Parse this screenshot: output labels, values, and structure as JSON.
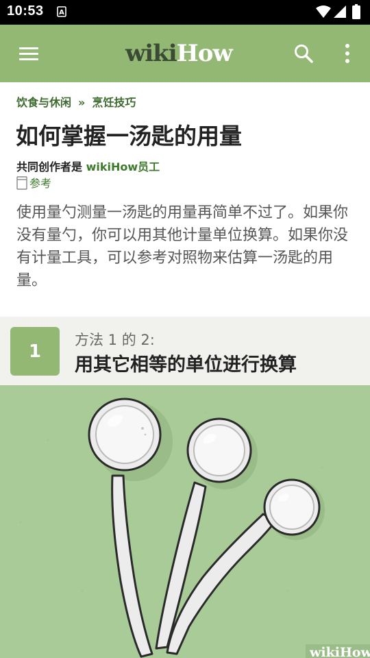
{
  "status_bar": {
    "time": "10:53",
    "icons": [
      "notification-a-icon",
      "wifi-icon",
      "signal-icon",
      "battery-icon"
    ]
  },
  "app_bar": {
    "logo_part1": "wiki",
    "logo_part2": "How",
    "icons": [
      "menu-icon",
      "search-icon",
      "more-vert-icon"
    ],
    "background": "#93b874"
  },
  "breadcrumb": {
    "items": [
      "饮食与休闲",
      "烹饪技巧"
    ],
    "separator": "»"
  },
  "article": {
    "title": "如何掌握一汤匙的用量",
    "coauthor_label": "共同创作者是",
    "coauthor_name": "wikiHow员工",
    "references_label": "参考",
    "intro": "使用量勺测量一汤匙的用量再简单不过了。如果你没有量勺，你可以用其他计量单位换算。如果你没有计量工具，可以参考对照物来估算一汤匙的用量。"
  },
  "method": {
    "number": "1",
    "subtitle": "方法 1 的 2:",
    "title": "用其它相等的单位进行换算"
  },
  "illustration": {
    "watermark": "wikiHow",
    "colors": {
      "background": "#a8cb98",
      "spoon": "#ececec",
      "outline": "#2a2a2a"
    }
  },
  "colors": {
    "accent": "#93b874",
    "link": "#3d7a2c",
    "status_bar": "#000000"
  }
}
